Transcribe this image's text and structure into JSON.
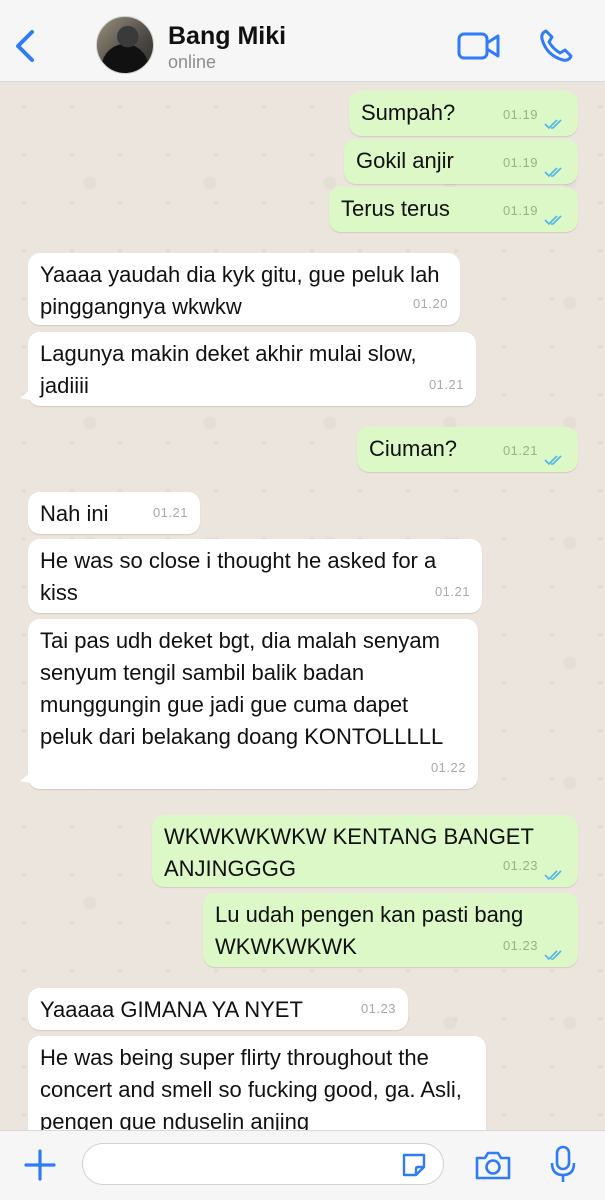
{
  "header": {
    "contact_name": "Bang Miki",
    "status": "online"
  },
  "colors": {
    "accent": "#2f7cf6",
    "outgoing_bubble": "#dcf8c6",
    "incoming_bubble": "#ffffff",
    "read_ticks": "#4fb5e8"
  },
  "icons": {
    "back": "chevron-left-icon",
    "video": "video-camera-icon",
    "call": "phone-icon",
    "attach": "plus-icon",
    "sticker": "sticker-icon",
    "camera": "camera-icon",
    "mic": "microphone-icon"
  },
  "messages": [
    {
      "dir": "out",
      "text": "Sumpah?",
      "time": "01.19",
      "read": true
    },
    {
      "dir": "out",
      "text": "Gokil anjir",
      "time": "01.19",
      "read": true
    },
    {
      "dir": "out",
      "text": "Terus terus",
      "time": "01.19",
      "read": true
    },
    {
      "dir": "in",
      "text": "Yaaaa yaudah dia kyk gitu, gue peluk lah pinggangnya wkwkw",
      "time": "01.20"
    },
    {
      "dir": "in",
      "text": "Lagunya makin deket akhir mulai slow, jadiiii",
      "time": "01.21"
    },
    {
      "dir": "out",
      "text": "Ciuman?",
      "time": "01.21",
      "read": true
    },
    {
      "dir": "in",
      "text": "Nah ini",
      "time": "01.21"
    },
    {
      "dir": "in",
      "text": "He was so close i thought he asked for a kiss",
      "time": "01.21"
    },
    {
      "dir": "in",
      "text": "Tai pas udh deket bgt, dia malah senyam senyum tengil sambil balik badan munggungin gue jadi gue cuma dapet peluk dari belakang doang KONTOLLLLL",
      "time": "01.22"
    },
    {
      "dir": "out",
      "text": "WKWKWKWKW KENTANG BANGET ANJINGGGG",
      "time": "01.23",
      "read": true
    },
    {
      "dir": "out",
      "text": "Lu udah pengen kan pasti bang WKWKWKWK",
      "time": "01.23",
      "read": true
    },
    {
      "dir": "in",
      "text": "Yaaaaa GIMANA YA NYET",
      "time": "01.23"
    },
    {
      "dir": "in",
      "text": "He was being super flirty throughout the concert and smell so fucking good, ga. Asli, pengen gue nduselin anjing",
      "time": ""
    }
  ],
  "composer": {
    "value": "",
    "placeholder": ""
  }
}
